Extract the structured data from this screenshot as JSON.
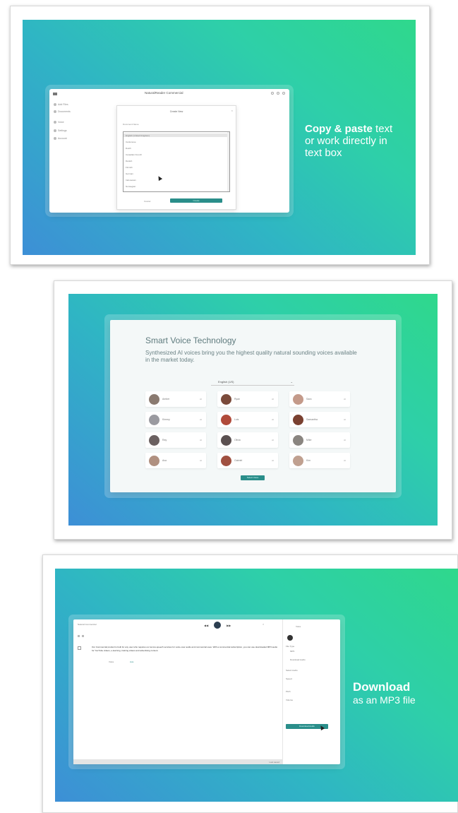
{
  "card1": {
    "app_title": "NaturalReader Commercial",
    "sidebar": [
      {
        "label": "Add Files"
      },
      {
        "label": "Documents"
      },
      {
        "label": "Voice"
      },
      {
        "label": "Settings"
      },
      {
        "label": "Account"
      }
    ],
    "dialog": {
      "title": "Create New",
      "field_label": "Document Name",
      "options": [
        "English (United Kingdom)",
        "Cantonese",
        "Dutch",
        "Canadian French",
        "Danish",
        "Finnish",
        "German",
        "Indonesian",
        "Norwegian"
      ],
      "cancel_label": "Cancel",
      "confirm_label": "Create"
    },
    "promo": {
      "bold": "Copy & paste",
      "rest1": " text",
      "rest2": "or work directly in",
      "rest3": "text box"
    }
  },
  "card2": {
    "title": "Smart Voice Technology",
    "subtitle": "Synthesized AI voices bring you the highest quality natural sounding voices available in the market today.",
    "language": "English (US)",
    "voices": [
      {
        "name": "Amber",
        "tag": "AI"
      },
      {
        "name": "Ryan",
        "tag": "AI"
      },
      {
        "name": "Sara",
        "tag": "AI"
      },
      {
        "name": "Kimmy",
        "tag": "AI"
      },
      {
        "name": "Luis",
        "tag": "AI"
      },
      {
        "name": "Samantha",
        "tag": "AI"
      },
      {
        "name": "Ray",
        "tag": "AI"
      },
      {
        "name": "Olivia",
        "tag": "AI"
      },
      {
        "name": "Mike",
        "tag": "AI"
      },
      {
        "name": "Ava",
        "tag": "AI"
      },
      {
        "name": "Gabriel",
        "tag": "AI"
      },
      {
        "name": "Kim",
        "tag": "AI"
      }
    ],
    "button_label": "Select Voice",
    "colors": {
      "avatars": [
        "#8a7a70",
        "#7a4a3a",
        "#c49a8a",
        "#9a9aa0",
        "#b04a3a",
        "#7a4030",
        "#6a6060",
        "#5a5050",
        "#8a8580",
        "#b09080",
        "#a05040",
        "#c0a090"
      ]
    }
  },
  "card3": {
    "doc_title": "Natural Commercial",
    "body_text": "Our Commercial product is built for any user who requires our text-to-speech services for voice-over audio and commercial uses. With a commercial subscription, you can use downloaded MP3 audio for YouTube videos, e-learning, training videos and advertising content.",
    "voice_label": "Voice",
    "voice_value": "Ava",
    "panel_items": [
      "Voice",
      "File Type",
      "MP3",
      "Download Audio",
      "Select Audio",
      "Speed",
      "Pitch",
      "Volume"
    ],
    "download_label": "Download Audio",
    "status": "Last saved",
    "promo": {
      "bold": "Download",
      "rest": "as an MP3 file"
    }
  }
}
